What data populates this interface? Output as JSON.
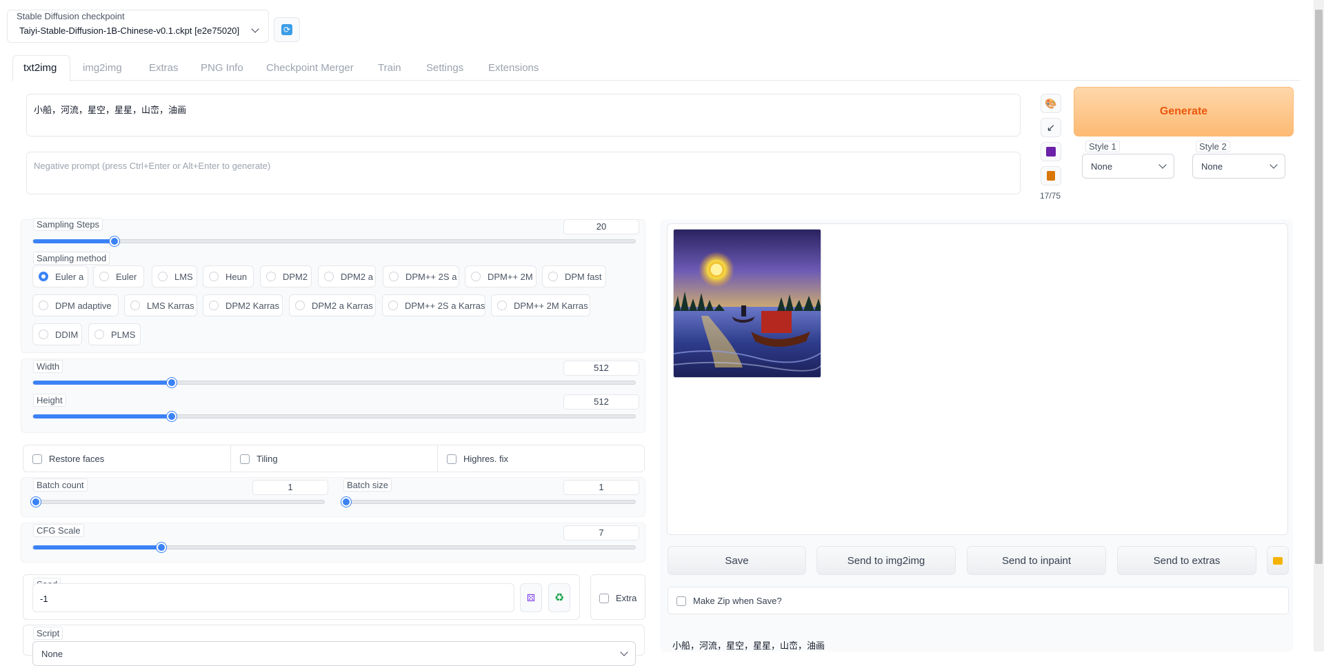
{
  "checkpoint": {
    "label": "Stable Diffusion checkpoint",
    "value": "Taiyi-Stable-Diffusion-1B-Chinese-v0.1.ckpt [e2e75020]",
    "refresh_icon": "refresh-icon"
  },
  "tabs": [
    "txt2img",
    "img2img",
    "Extras",
    "PNG Info",
    "Checkpoint Merger",
    "Train",
    "Settings",
    "Extensions"
  ],
  "active_tab": "txt2img",
  "prompt": {
    "value": "小船，河流，星空，星星，山峦，油画",
    "negative_placeholder": "Negative prompt (press Ctrl+Enter or Alt+Enter to generate)",
    "token_count": "17/75"
  },
  "tool_icons": [
    "palette-icon",
    "arrow-icon",
    "save-icon",
    "clipboard-icon"
  ],
  "generate": {
    "label": "Generate"
  },
  "styles": {
    "style1": {
      "label": "Style 1",
      "value": "None"
    },
    "style2": {
      "label": "Style 2",
      "value": "None"
    }
  },
  "sampling_steps": {
    "label": "Sampling Steps",
    "value": "20",
    "fraction": 0.13
  },
  "sampling_method": {
    "label": "Sampling method",
    "selected": "Euler a",
    "options": [
      "Euler a",
      "Euler",
      "LMS",
      "Heun",
      "DPM2",
      "DPM2 a",
      "DPM++ 2S a",
      "DPM++ 2M",
      "DPM fast",
      "DPM adaptive",
      "LMS Karras",
      "DPM2 Karras",
      "DPM2 a Karras",
      "DPM++ 2S a Karras",
      "DPM++ 2M Karras",
      "DDIM",
      "PLMS"
    ]
  },
  "width": {
    "label": "Width",
    "value": "512",
    "fraction": 0.23
  },
  "height": {
    "label": "Height",
    "value": "512",
    "fraction": 0.23
  },
  "checkboxes": {
    "restore_faces": "Restore faces",
    "tiling": "Tiling",
    "highres_fix": "Highres. fix"
  },
  "batch_count": {
    "label": "Batch count",
    "value": "1",
    "fraction": 0.0
  },
  "batch_size": {
    "label": "Batch size",
    "value": "1",
    "fraction": 0.0
  },
  "cfg_scale": {
    "label": "CFG Scale",
    "value": "7",
    "fraction": 0.21
  },
  "seed": {
    "label": "Seed",
    "value": "-1",
    "extra_label": "Extra",
    "dice_icon": "dice-icon",
    "recycle_icon": "recycle-icon"
  },
  "script": {
    "label": "Script",
    "value": "None"
  },
  "output": {
    "buttons": [
      "Save",
      "Send to img2img",
      "Send to inpaint",
      "Send to extras"
    ],
    "folder_icon": "folder-icon",
    "zip_label": "Make Zip when Save?",
    "caption": "小船，河流，星空，星星，山峦，油画"
  },
  "colors": {
    "accent": "#3b82f6",
    "generate_bg": "#fdba74",
    "generate_text": "#ea580c"
  }
}
